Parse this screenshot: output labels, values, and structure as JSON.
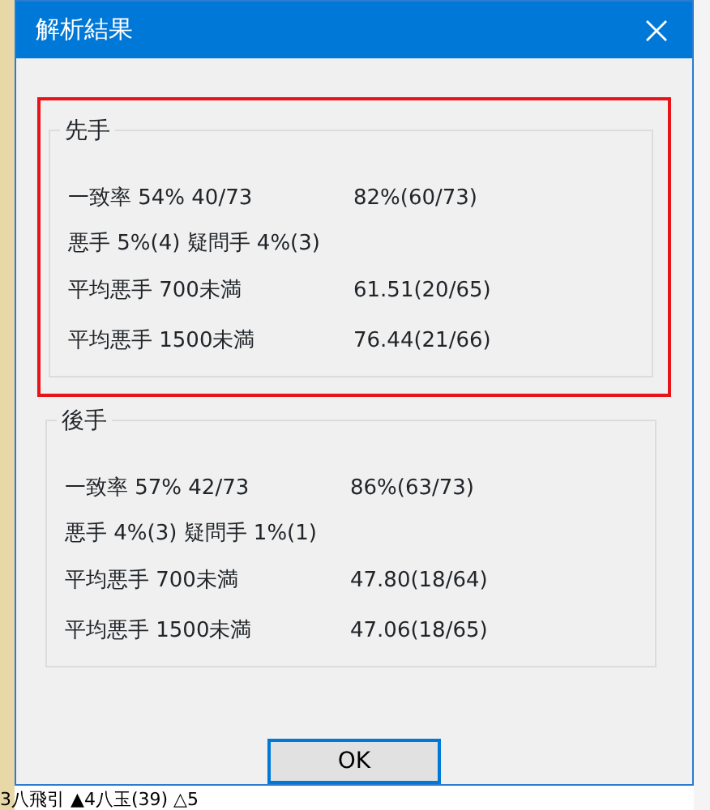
{
  "window": {
    "title": "解析結果"
  },
  "groups": [
    {
      "title": "先手",
      "highlighted": true,
      "rows": [
        {
          "label": "一致率 54% 40/73",
          "value": "82%(60/73)"
        },
        {
          "label": "悪手 5%(4) 疑問手 4%(3)"
        },
        {
          "label": "平均悪手 700未満",
          "value": "61.51(20/65)"
        },
        {
          "label": "平均悪手 1500未満",
          "value": "76.44(21/66)"
        }
      ]
    },
    {
      "title": "後手",
      "highlighted": false,
      "rows": [
        {
          "label": "一致率 57% 42/73",
          "value": "86%(63/73)"
        },
        {
          "label": "悪手 4%(3) 疑問手 1%(1)"
        },
        {
          "label": "平均悪手 700未満",
          "value": "47.80(18/64)"
        },
        {
          "label": "平均悪手 1500未満",
          "value": "47.06(18/65)"
        }
      ]
    }
  ],
  "buttons": [
    {
      "label": "OK"
    }
  ],
  "background": {
    "move_text": "3八飛引 ▲4八玉(39) △5"
  }
}
